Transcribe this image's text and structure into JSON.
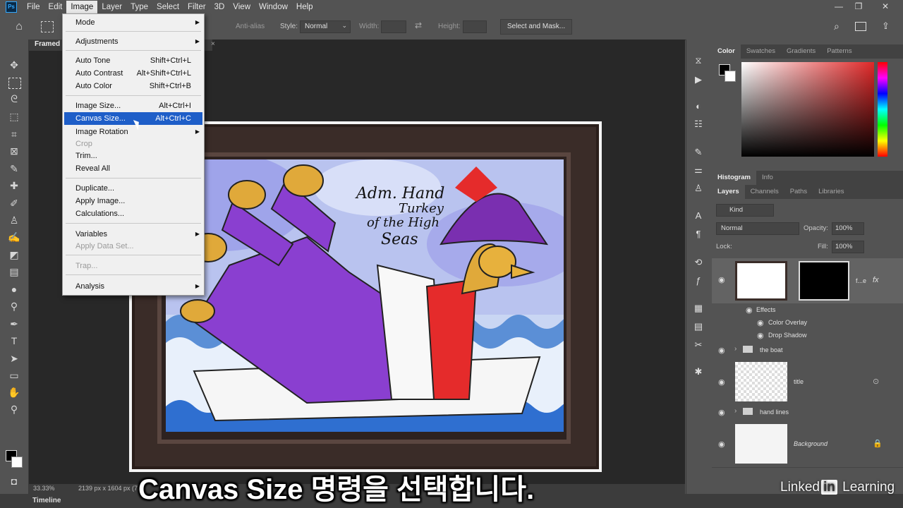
{
  "app": {
    "name": "Ps"
  },
  "menubar": {
    "items": [
      "File",
      "Edit",
      "Image",
      "Layer",
      "Type",
      "Select",
      "Filter",
      "3D",
      "View",
      "Window",
      "Help"
    ],
    "active": "Image"
  },
  "window_controls": {
    "minimize": "—",
    "restore": "❐",
    "close": "✕"
  },
  "options": {
    "anti_alias": "Anti-alias",
    "style_label": "Style:",
    "style_value": "Normal",
    "width_label": "Width:",
    "height_label": "Height:",
    "select_mask": "Select and Mask..."
  },
  "document": {
    "tab": "Framed"
  },
  "image_menu": {
    "items": [
      {
        "label": "Mode",
        "shortcut": "",
        "submenu": true,
        "disabled": false
      },
      {
        "label": "Adjustments",
        "shortcut": "",
        "submenu": true,
        "disabled": false
      },
      {
        "label": "Auto Tone",
        "shortcut": "Shift+Ctrl+L",
        "submenu": false,
        "disabled": false
      },
      {
        "label": "Auto Contrast",
        "shortcut": "Alt+Shift+Ctrl+L",
        "submenu": false,
        "disabled": false
      },
      {
        "label": "Auto Color",
        "shortcut": "Shift+Ctrl+B",
        "submenu": false,
        "disabled": false
      },
      {
        "label": "Image Size...",
        "shortcut": "Alt+Ctrl+I",
        "submenu": false,
        "disabled": false
      },
      {
        "label": "Canvas Size...",
        "shortcut": "Alt+Ctrl+C",
        "submenu": false,
        "disabled": false,
        "highlighted": true
      },
      {
        "label": "Image Rotation",
        "shortcut": "",
        "submenu": true,
        "disabled": false
      },
      {
        "label": "Crop",
        "shortcut": "",
        "submenu": false,
        "disabled": true
      },
      {
        "label": "Trim...",
        "shortcut": "",
        "submenu": false,
        "disabled": false
      },
      {
        "label": "Reveal All",
        "shortcut": "",
        "submenu": false,
        "disabled": false
      },
      {
        "label": "Duplicate...",
        "shortcut": "",
        "submenu": false,
        "disabled": false
      },
      {
        "label": "Apply Image...",
        "shortcut": "",
        "submenu": false,
        "disabled": false
      },
      {
        "label": "Calculations...",
        "shortcut": "",
        "submenu": false,
        "disabled": false
      },
      {
        "label": "Variables",
        "shortcut": "",
        "submenu": true,
        "disabled": false
      },
      {
        "label": "Apply Data Set...",
        "shortcut": "",
        "submenu": false,
        "disabled": true
      },
      {
        "label": "Trap...",
        "shortcut": "",
        "submenu": false,
        "disabled": true
      },
      {
        "label": "Analysis",
        "shortcut": "",
        "submenu": true,
        "disabled": false
      }
    ]
  },
  "artwork": {
    "title_text": [
      "Adm. Hand",
      "Turkey",
      "of the High",
      "Seas"
    ]
  },
  "status": {
    "zoom": "33.33%",
    "dimensions": "2139 px x 1604 px (7..."
  },
  "timeline": {
    "label": "Timeline"
  },
  "color_panel": {
    "tabs": [
      "Color",
      "Swatches",
      "Gradients",
      "Patterns"
    ],
    "active": "Color",
    "hue_color": "#e03030"
  },
  "histogram_panel": {
    "tabs": [
      "Histogram",
      "Info"
    ],
    "active": "Histogram"
  },
  "layers_panel": {
    "tabs": [
      "Layers",
      "Channels",
      "Paths",
      "Libraries"
    ],
    "active": "Layers",
    "filter_kind": "Kind",
    "blend_mode": "Normal",
    "opacity_label": "Opacity:",
    "opacity_value": "100%",
    "lock_label": "Lock:",
    "fill_label": "Fill:",
    "fill_value": "100%",
    "layers": [
      {
        "name": "f...e",
        "fx": "fx"
      },
      {
        "name": "Effects"
      },
      {
        "name": "Color Overlay"
      },
      {
        "name": "Drop Shadow"
      },
      {
        "name": "the boat"
      },
      {
        "name": "title"
      },
      {
        "name": "hand lines"
      },
      {
        "name": "Background"
      }
    ]
  },
  "subtitle": {
    "text": "Canvas Size 명령을 선택합니다."
  },
  "watermark": {
    "part1": "Linked",
    "part2": "in",
    "part3": " Learning"
  }
}
